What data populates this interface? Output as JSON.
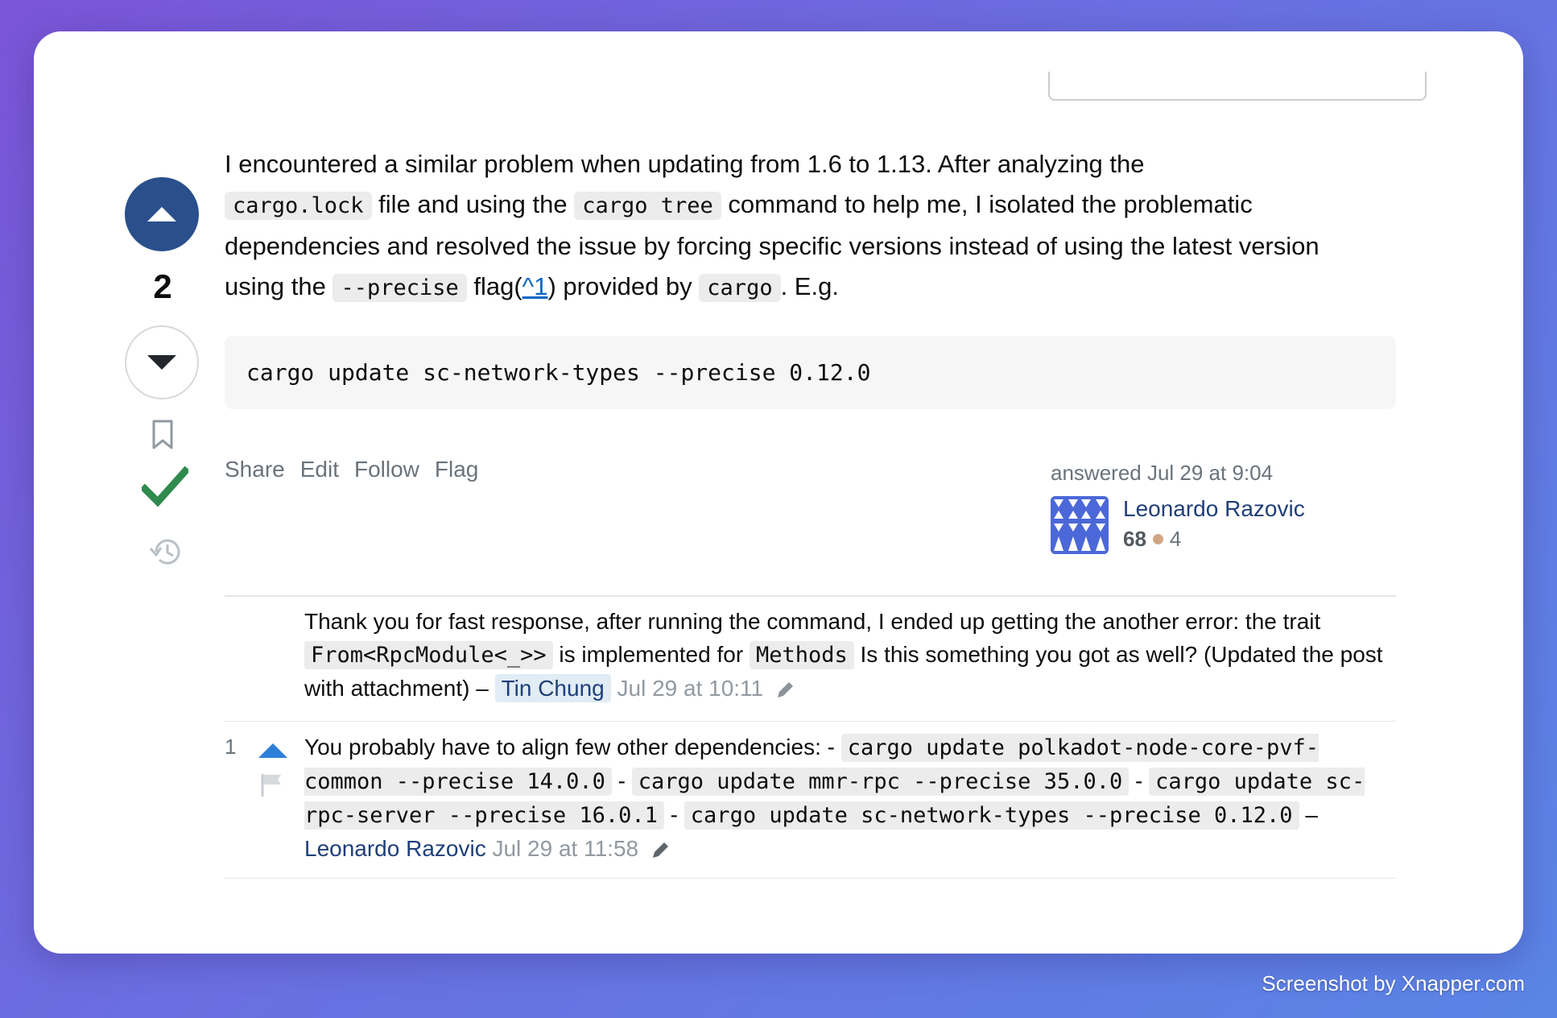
{
  "vote": {
    "score": "2"
  },
  "answer": {
    "p1_a": "I encountered a similar problem when updating from 1.6 to 1.13. After analyzing the",
    "code_lock": "cargo.lock",
    "p1_b": " file and using the ",
    "code_tree": "cargo tree",
    "p1_c": " command to help me, I isolated the problematic dependencies and resolved the issue by forcing specific versions instead of using the latest version using the ",
    "code_precise": "--precise",
    "p1_d": " flag(",
    "footnote_link": "^1",
    "p1_e": ") provided by ",
    "code_cargo": "cargo",
    "p1_f": ". E.g.",
    "code_block": "cargo update sc-network-types --precise 0.12.0"
  },
  "post_menu": {
    "share": "Share",
    "edit": "Edit",
    "follow": "Follow",
    "flag": "Flag"
  },
  "signature": {
    "action_time": "answered Jul 29 at 9:04",
    "user_name": "Leonardo Razovic",
    "reputation": "68",
    "bronze_badges": "4"
  },
  "comments": [
    {
      "score": "",
      "t1": "Thank you for fast response, after running the command, I ended up getting the another error: the trait ",
      "c1": "From<RpcModule<_>>",
      "t2": " is implemented for ",
      "c2": "Methods",
      "t3": " Is this something you got as well? (Updated the post with attachment) – ",
      "user": "Tin Chung",
      "time": "Jul 29 at 10:11"
    },
    {
      "score": "1",
      "t1": "You probably have to align few other dependencies: - ",
      "c1": "cargo update polkadot-node-core-pvf-common --precise 14.0.0",
      "t2": " - ",
      "c2": "cargo update mmr-rpc --precise 35.0.0",
      "t3": " - ",
      "c3": "cargo update sc-rpc-server  --precise 16.0.1",
      "t4": " - ",
      "c4": "cargo update sc-network-types --precise 0.12.0",
      "t5": " – ",
      "user": "Leonardo Razovic",
      "time": "Jul 29 at 11:58"
    }
  ],
  "watermark": "Screenshot by Xnapper.com",
  "colors": {
    "upvote_active": "#2a4f8b",
    "accepted": "#2f8a4e",
    "link": "#0a66c2",
    "user": "#1f3f78"
  },
  "icons": [
    "upvote-icon",
    "downvote-icon",
    "bookmark-icon",
    "accepted-check-icon",
    "history-icon",
    "pencil-icon",
    "flag-icon"
  ]
}
